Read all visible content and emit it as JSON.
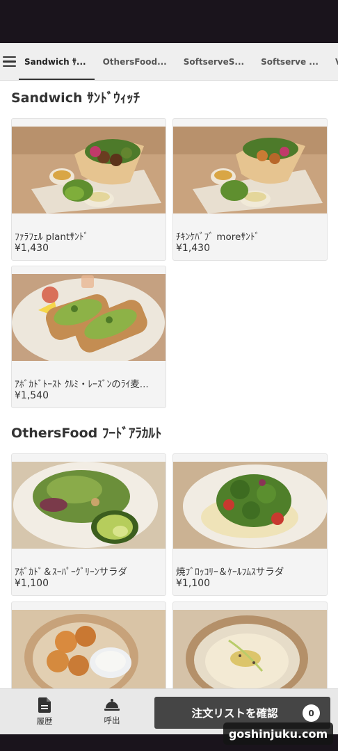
{
  "tabs": [
    {
      "label": "Sandwich ｻ..."
    },
    {
      "label": "OthersFood..."
    },
    {
      "label": "SoftserveS..."
    },
    {
      "label": "Softserve ..."
    },
    {
      "label": "VeganCake"
    }
  ],
  "sections": [
    {
      "title": "Sandwich ｻﾝﾄﾞｳｨｯﾁ",
      "items": [
        {
          "name": "ﾌｧﾗﾌｪﾙ plantｻﾝﾄﾞ",
          "price": "¥1,430"
        },
        {
          "name": "ﾁｷﾝｹﾊﾞﾌﾞ moreｻﾝﾄﾞ",
          "price": "¥1,430"
        },
        {
          "name": "ｱﾎﾞｶﾄﾞﾄｰｽﾄ ｸﾙﾐ・ﾚｰｽﾞﾝのﾗｲ麦...",
          "price": "¥1,540"
        }
      ]
    },
    {
      "title": "OthersFood ﾌｰﾄﾞｱﾗｶﾙﾄ",
      "items": [
        {
          "name": "ｱﾎﾞｶﾄﾞ＆ｽｰﾊﾟｰｸﾞﾘｰﾝサラダ",
          "price": "¥1,100"
        },
        {
          "name": "焼ﾌﾞﾛｯｺﾘｰ＆ｹｰﾙﾌﾑｽサラダ",
          "price": "¥1,100"
        },
        {
          "name": "",
          "price": ""
        },
        {
          "name": "",
          "price": ""
        }
      ]
    }
  ],
  "bottom": {
    "history_label": "履歴",
    "call_label": "呼出",
    "order_label": "注文リストを確認",
    "order_count": "0"
  },
  "watermark": "goshinjuku.com",
  "colors": {
    "accent": "#454545",
    "status_bar": "#1a141c"
  },
  "icons": [
    "menu-icon",
    "document-icon",
    "bell-icon"
  ]
}
